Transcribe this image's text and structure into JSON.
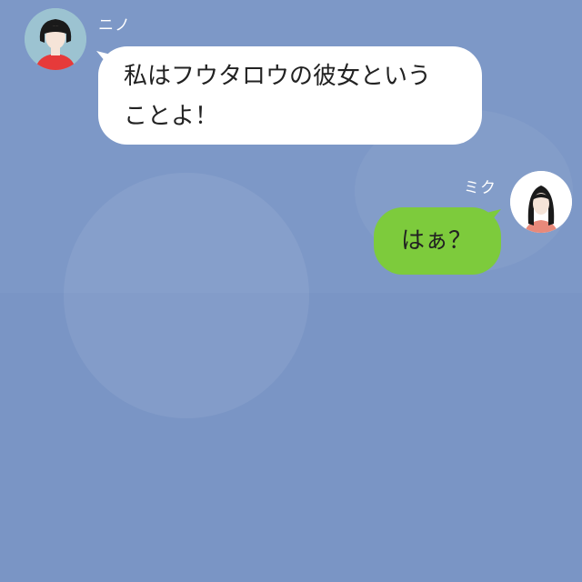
{
  "messages": [
    {
      "sender": "ニノ",
      "side": "left",
      "text_lines": [
        "私はフウタロウの彼女という",
        "ことよ！"
      ],
      "avatar_icon": "woman-bob-hair-red-shirt-avatar-icon",
      "bubble_color": "#ffffff"
    },
    {
      "sender": "ミク",
      "side": "right",
      "text_lines": [
        "はぁ？"
      ],
      "avatar_icon": "woman-long-hair-avatar-icon",
      "bubble_color": "#7dcb3c"
    }
  ],
  "colors": {
    "background": "#7b97c6",
    "sender_name": "#ffffff"
  }
}
